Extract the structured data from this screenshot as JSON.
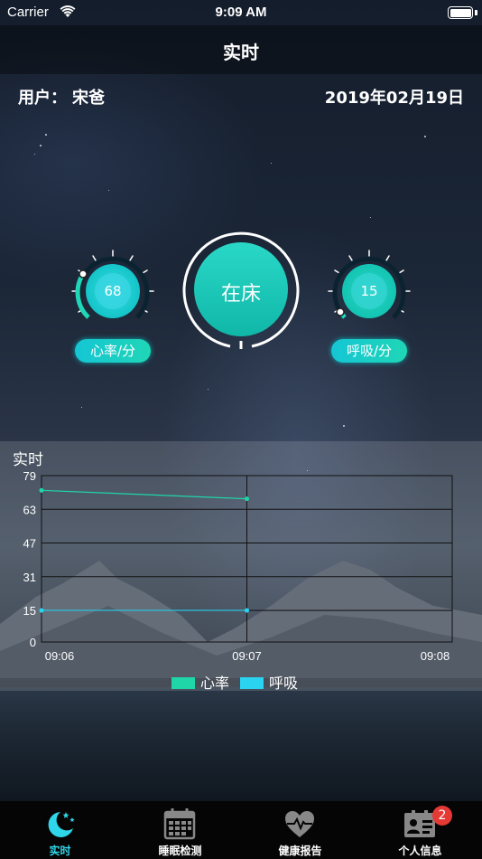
{
  "status_bar": {
    "carrier": "Carrier",
    "time": "9:09 AM"
  },
  "nav": {
    "title": "实时"
  },
  "info": {
    "user_label": "用户：",
    "user_name": "宋爸",
    "date": "2019年02月19日"
  },
  "gauges": {
    "heart_rate": {
      "value": "68",
      "label": "心率/分"
    },
    "bed_status": "在床",
    "breathing": {
      "value": "15",
      "label": "呼吸/分"
    }
  },
  "colors": {
    "accent": "#2fd6ea",
    "heart_series": "#1fd6a8",
    "breath_series": "#2ad4f0",
    "badge": "#e53935"
  },
  "chart_data": {
    "type": "line",
    "title": "实时",
    "x": [
      "09:06",
      "09:07",
      "09:08"
    ],
    "yticks": [
      "79",
      "63",
      "47",
      "31",
      "15",
      "0"
    ],
    "ylim": [
      0,
      79
    ],
    "grid": true,
    "legend": "bottom",
    "series": [
      {
        "name": "心率",
        "color": "#1fd6a8",
        "x": [
          "09:06",
          "09:07"
        ],
        "values": [
          72,
          68
        ]
      },
      {
        "name": "呼吸",
        "color": "#2ad4f0",
        "x": [
          "09:06",
          "09:07"
        ],
        "values": [
          15,
          15
        ]
      }
    ]
  },
  "tabbar": {
    "items": [
      {
        "label": "实时",
        "icon": "moon-stars-icon",
        "active": true
      },
      {
        "label": "睡眠检测",
        "icon": "calendar-icon",
        "active": false
      },
      {
        "label": "健康报告",
        "icon": "heart-pulse-icon",
        "active": false
      },
      {
        "label": "个人信息",
        "icon": "id-card-icon",
        "active": false,
        "badge": "2"
      }
    ]
  }
}
